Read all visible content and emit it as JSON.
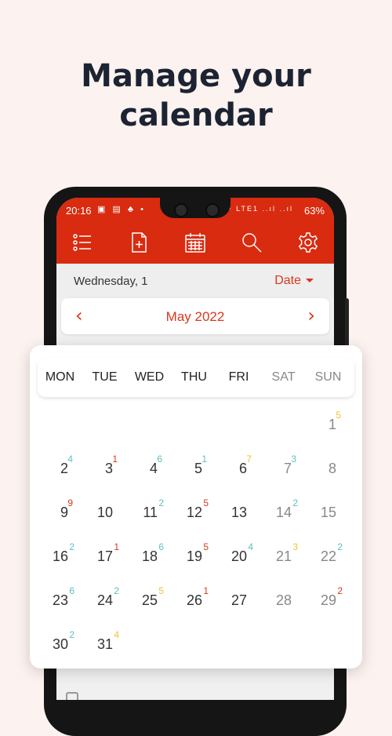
{
  "headline": {
    "line1": "Manage your",
    "line2": "calendar"
  },
  "statusbar": {
    "time": "20:16",
    "left_icons": "▣ ▤ ♣ •",
    "right_icons": "Vo0 4G+ LTE1 ..ıl ..ıl",
    "battery": "63%"
  },
  "toolbar": {
    "icons": [
      "checklist-icon",
      "new-note-icon",
      "calendar-icon",
      "search-icon",
      "settings-icon"
    ]
  },
  "datebar": {
    "label": "Wednesday, 1",
    "sort": "Date"
  },
  "monthbar": {
    "prev": "‹",
    "title": "May 2022",
    "next": "›"
  },
  "calendar": {
    "weekdays": [
      "MON",
      "TUE",
      "WED",
      "THU",
      "FRI",
      "SAT",
      "SUN"
    ],
    "days": [
      {
        "n": "1",
        "c": "5",
        "cc": "#f1c232",
        "col": 6,
        "row": 0
      },
      {
        "n": "2",
        "c": "4",
        "cc": "#5cc0be",
        "col": 0,
        "row": 1
      },
      {
        "n": "3",
        "c": "1",
        "cc": "#d9381e",
        "col": 1,
        "row": 1
      },
      {
        "n": "4",
        "c": "6",
        "cc": "#5cc0be",
        "col": 2,
        "row": 1
      },
      {
        "n": "5",
        "c": "1",
        "cc": "#5cc0be",
        "col": 3,
        "row": 1
      },
      {
        "n": "6",
        "c": "7",
        "cc": "#f1c232",
        "col": 4,
        "row": 1
      },
      {
        "n": "7",
        "c": "3",
        "cc": "#5cc0be",
        "col": 5,
        "row": 1
      },
      {
        "n": "8",
        "c": "",
        "cc": "",
        "col": 6,
        "row": 1
      },
      {
        "n": "9",
        "c": "9",
        "cc": "#d9381e",
        "col": 0,
        "row": 2
      },
      {
        "n": "10",
        "c": "",
        "cc": "",
        "col": 1,
        "row": 2
      },
      {
        "n": "11",
        "c": "2",
        "cc": "#5cc0be",
        "col": 2,
        "row": 2
      },
      {
        "n": "12",
        "c": "5",
        "cc": "#d9381e",
        "col": 3,
        "row": 2
      },
      {
        "n": "13",
        "c": "",
        "cc": "",
        "col": 4,
        "row": 2
      },
      {
        "n": "14",
        "c": "2",
        "cc": "#5cc0be",
        "col": 5,
        "row": 2
      },
      {
        "n": "15",
        "c": "",
        "cc": "",
        "col": 6,
        "row": 2
      },
      {
        "n": "16",
        "c": "2",
        "cc": "#5cc0be",
        "col": 0,
        "row": 3
      },
      {
        "n": "17",
        "c": "1",
        "cc": "#d9381e",
        "col": 1,
        "row": 3
      },
      {
        "n": "18",
        "c": "6",
        "cc": "#5cc0be",
        "col": 2,
        "row": 3
      },
      {
        "n": "19",
        "c": "5",
        "cc": "#d9381e",
        "col": 3,
        "row": 3
      },
      {
        "n": "20",
        "c": "4",
        "cc": "#5cc0be",
        "col": 4,
        "row": 3
      },
      {
        "n": "21",
        "c": "3",
        "cc": "#f1c232",
        "col": 5,
        "row": 3
      },
      {
        "n": "22",
        "c": "2",
        "cc": "#5cc0be",
        "col": 6,
        "row": 3
      },
      {
        "n": "23",
        "c": "6",
        "cc": "#5cc0be",
        "col": 0,
        "row": 4
      },
      {
        "n": "24",
        "c": "2",
        "cc": "#5cc0be",
        "col": 1,
        "row": 4
      },
      {
        "n": "25",
        "c": "5",
        "cc": "#f1c232",
        "col": 2,
        "row": 4
      },
      {
        "n": "26",
        "c": "1",
        "cc": "#d9381e",
        "col": 3,
        "row": 4
      },
      {
        "n": "27",
        "c": "",
        "cc": "",
        "col": 4,
        "row": 4
      },
      {
        "n": "28",
        "c": "",
        "cc": "",
        "col": 5,
        "row": 4
      },
      {
        "n": "29",
        "c": "2",
        "cc": "#d9381e",
        "col": 6,
        "row": 4
      },
      {
        "n": "30",
        "c": "2",
        "cc": "#5cc0be",
        "col": 0,
        "row": 5
      },
      {
        "n": "31",
        "c": "4",
        "cc": "#f1c232",
        "col": 1,
        "row": 5
      }
    ]
  },
  "colors": {
    "accent": "#d92b0f",
    "background": "#fcf2ef",
    "headline": "#1c2333"
  }
}
